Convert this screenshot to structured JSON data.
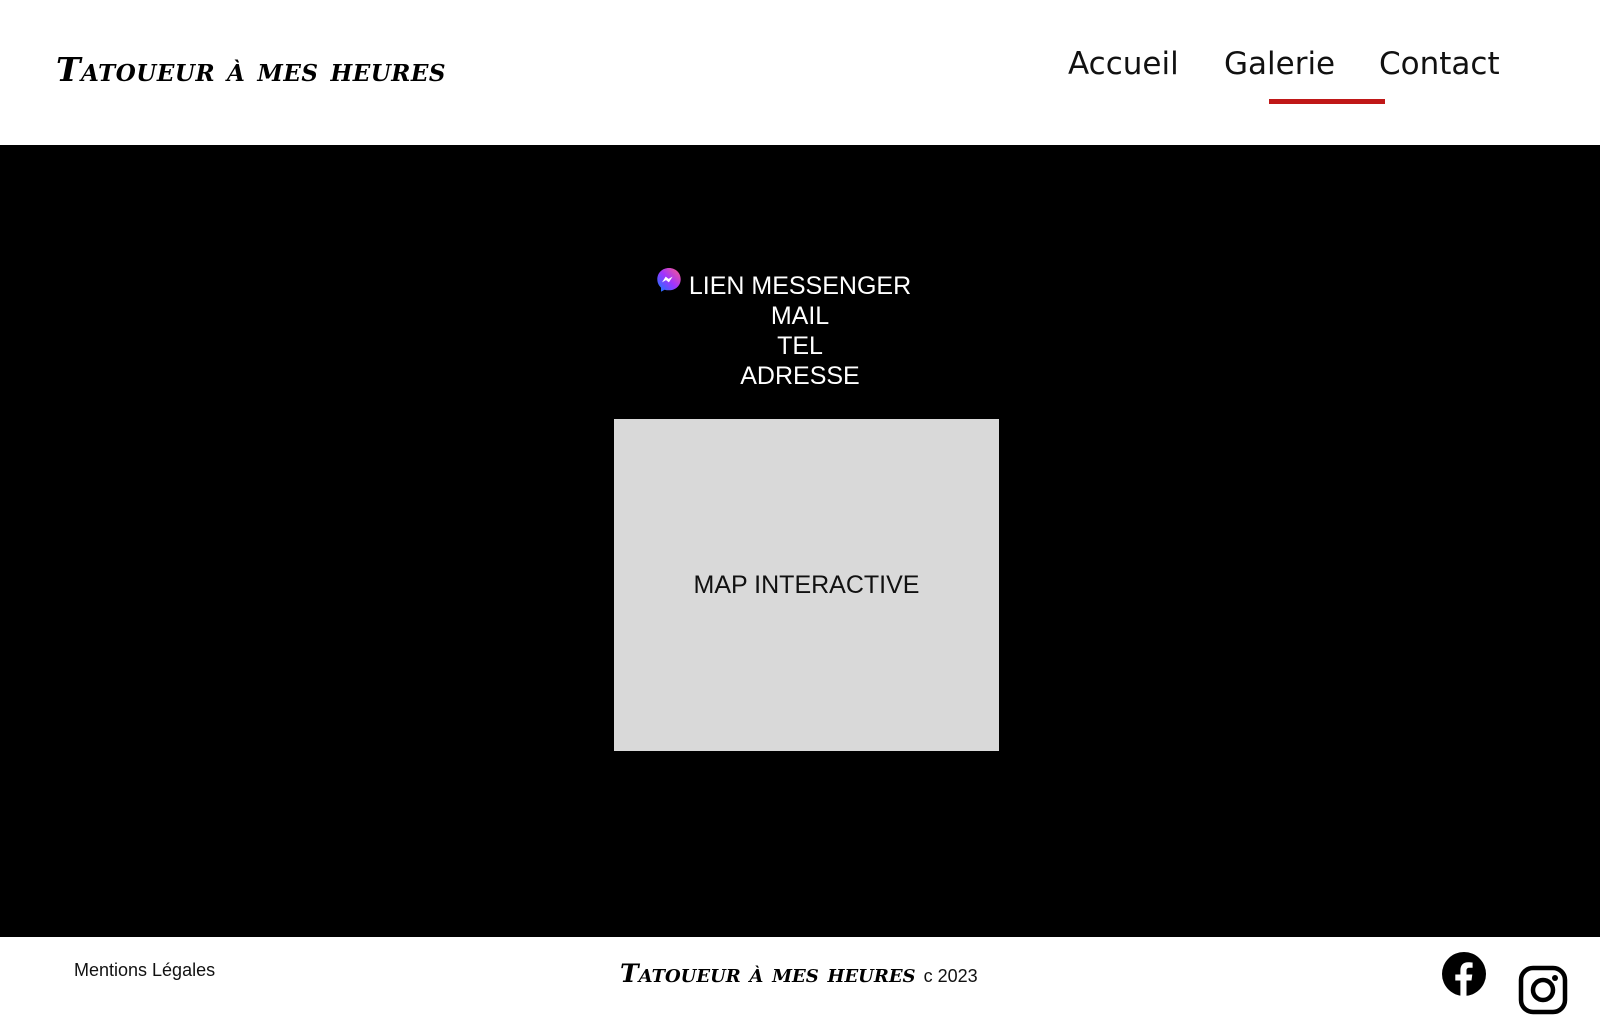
{
  "header": {
    "logo": "Tatoueur à mes heures",
    "nav": [
      {
        "label": "Accueil"
      },
      {
        "label": "Galerie"
      },
      {
        "label": "Contact"
      }
    ],
    "accent_color": "#c01818"
  },
  "main": {
    "contact_lines": [
      "LIEN MESSENGER",
      "MAIL",
      "TEL",
      "ADRESSE"
    ],
    "messenger_icon": "messenger-icon",
    "map_label": "MAP INTERACTIVE"
  },
  "footer": {
    "legal_label": "Mentions Légales",
    "brand": "Tatoueur à mes heures",
    "copyright": "c  2023",
    "social_icons": [
      "facebook-icon",
      "instagram-icon"
    ]
  }
}
